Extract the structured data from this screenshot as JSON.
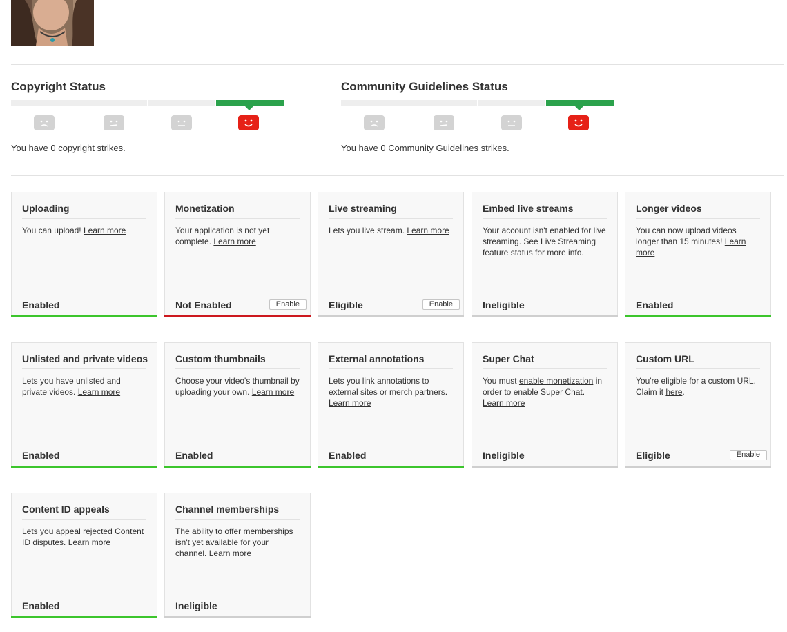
{
  "copyright": {
    "title": "Copyright Status",
    "text": "You have 0 copyright strikes.",
    "active_index": 3
  },
  "community": {
    "title": "Community Guidelines Status",
    "text": "You have 0 Community Guidelines strikes.",
    "active_index": 3
  },
  "colors": {
    "active_bar": "#2ba24c",
    "active_face": "#e62117",
    "enabled": "#3cc52c",
    "not_enabled": "#cc181e",
    "neutral": "#cfcfcf"
  },
  "features": [
    {
      "title": "Uploading",
      "desc": "You can upload!",
      "link": "Learn more",
      "status": "Enabled",
      "bar": "green",
      "button": ""
    },
    {
      "title": "Monetization",
      "desc": "Your application is not yet complete.",
      "link": "Learn more",
      "status": "Not Enabled",
      "bar": "red",
      "button": "Enable"
    },
    {
      "title": "Live streaming",
      "desc": "Lets you live stream.",
      "link": "Learn more",
      "status": "Eligible",
      "bar": "gray",
      "button": "Enable"
    },
    {
      "title": "Embed live streams",
      "desc": "Your account isn't enabled for live streaming. See Live Streaming feature status for more info.",
      "link": "",
      "status": "Ineligible",
      "bar": "gray",
      "button": ""
    },
    {
      "title": "Longer videos",
      "desc": "You can now upload videos longer than 15 minutes!",
      "link": "Learn more",
      "status": "Enabled",
      "bar": "green",
      "button": ""
    },
    {
      "title": "Unlisted and private videos",
      "desc": "Lets you have unlisted and private videos.",
      "link": "Learn more",
      "status": "Enabled",
      "bar": "green",
      "button": ""
    },
    {
      "title": "Custom thumbnails",
      "desc": "Choose your video's thumbnail by uploading your own.",
      "link": "Learn more",
      "status": "Enabled",
      "bar": "green",
      "button": ""
    },
    {
      "title": "External annotations",
      "desc": "Lets you link annotations to external sites or merch partners.",
      "link": "Learn more",
      "status": "Enabled",
      "bar": "green",
      "button": ""
    },
    {
      "title": "Super Chat",
      "desc_pre": "You must",
      "desc_link": "enable monetization",
      "desc_post": "in order to enable Super Chat.",
      "link": "Learn more",
      "status": "Ineligible",
      "bar": "gray",
      "button": ""
    },
    {
      "title": "Custom URL",
      "desc_pre": "You're eligible for a custom URL. Claim it",
      "desc_link": "here",
      "desc_post": ".",
      "link": "",
      "status": "Eligible",
      "bar": "gray",
      "button": "Enable"
    },
    {
      "title": "Content ID appeals",
      "desc": "Lets you appeal rejected Content ID disputes.",
      "link": "Learn more",
      "status": "Enabled",
      "bar": "green",
      "button": ""
    },
    {
      "title": "Channel memberships",
      "desc": "The ability to offer memberships isn't yet available for your channel.",
      "link": "Learn more",
      "status": "Ineligible",
      "bar": "gray",
      "button": ""
    }
  ]
}
